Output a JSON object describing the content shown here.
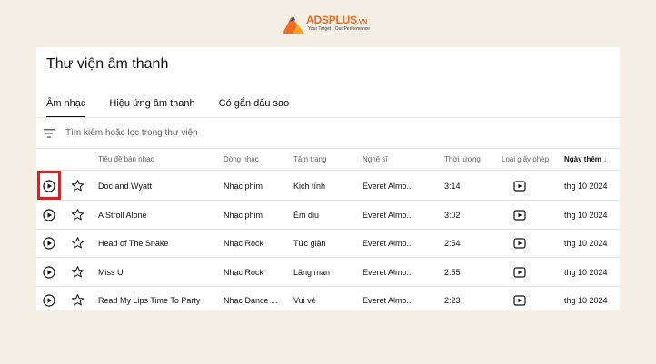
{
  "logo": {
    "brand": "ADSPLUS",
    "brand_suffix": ".VN",
    "tagline": "Your Target · Our Performance"
  },
  "page_title": "Thư viện âm thanh",
  "tabs": [
    {
      "label": "Âm nhạc",
      "active": true
    },
    {
      "label": "Hiệu ứng âm thanh",
      "active": false
    },
    {
      "label": "Có gắn dấu sao",
      "active": false
    }
  ],
  "search": {
    "placeholder": "Tìm kiếm hoặc lọc trong thư viện"
  },
  "columns": {
    "title": "Tiêu đề bản nhạc",
    "genre": "Dòng nhạc",
    "mood": "Tâm trạng",
    "artist": "Nghệ sĩ",
    "duration": "Thời lượng",
    "license": "Loại giấy phép",
    "date_added": "Ngày thêm",
    "sort_indicator": "↓"
  },
  "tracks": [
    {
      "title": "Doc and Wyatt",
      "genre": "Nhạc phim",
      "mood": "Kịch tính",
      "artist": "Everet Almo...",
      "duration": "3:14",
      "date": "thg 10 2024"
    },
    {
      "title": "A Stroll Alone",
      "genre": "Nhạc phim",
      "mood": "Êm dịu",
      "artist": "Everet Almo...",
      "duration": "3:02",
      "date": "thg 10 2024"
    },
    {
      "title": "Head of The Snake",
      "genre": "Nhạc Rock",
      "mood": "Tức giận",
      "artist": "Everet Almo...",
      "duration": "2:54",
      "date": "thg 10 2024"
    },
    {
      "title": "Miss U",
      "genre": "Nhạc Rock",
      "mood": "Lãng mạn",
      "artist": "Everet Almo...",
      "duration": "2:55",
      "date": "thg 10 2024"
    },
    {
      "title": "Read My Lips Time To Party",
      "genre": "Nhạc Dance ...",
      "mood": "Vui vẻ",
      "artist": "Everet Almo...",
      "duration": "2:23",
      "date": "thg 10 2024"
    }
  ],
  "colors": {
    "highlight": "#e51b23",
    "brand": "#f26b21",
    "background": "#f4efe4"
  },
  "icons": {
    "play": "play-circle-icon",
    "star": "star-outline-icon",
    "license": "youtube-license-icon",
    "filter": "filter-icon"
  }
}
